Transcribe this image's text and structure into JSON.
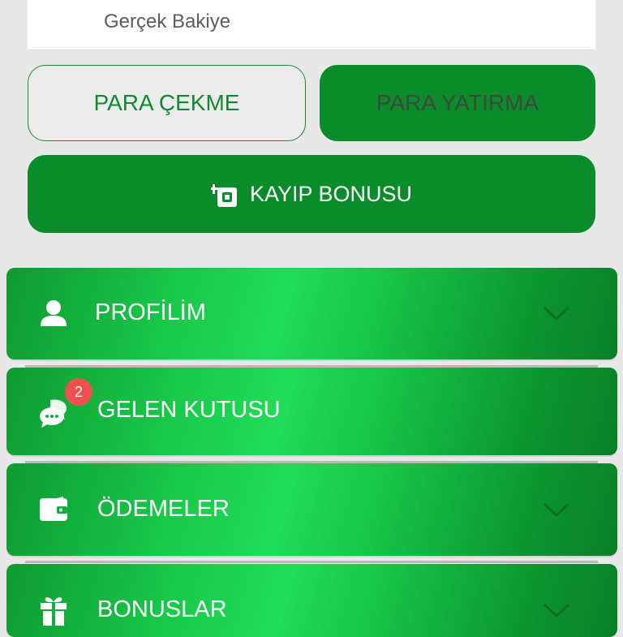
{
  "balance": {
    "label": "Gerçek Bakiye"
  },
  "actions": {
    "withdraw_label": "PARA ÇEKME",
    "deposit_label": "PARA YATIRMA",
    "loss_bonus_label": "KAYIP BONUSU"
  },
  "menu": {
    "items": [
      {
        "label": "PROFİLİM",
        "icon": "user-icon",
        "expandable": true
      },
      {
        "label": "GELEN KUTUSU",
        "icon": "chat-icon",
        "badge": "2",
        "expandable": false
      },
      {
        "label": "ÖDEMELER",
        "icon": "wallet-icon",
        "expandable": true
      },
      {
        "label": "BONUSLAR",
        "icon": "gift-icon",
        "expandable": true
      }
    ]
  },
  "colors": {
    "primary_green": "#0a8c2a",
    "bright_green": "#20dd58",
    "badge_red": "#f25050",
    "background": "#e8e8e8"
  }
}
